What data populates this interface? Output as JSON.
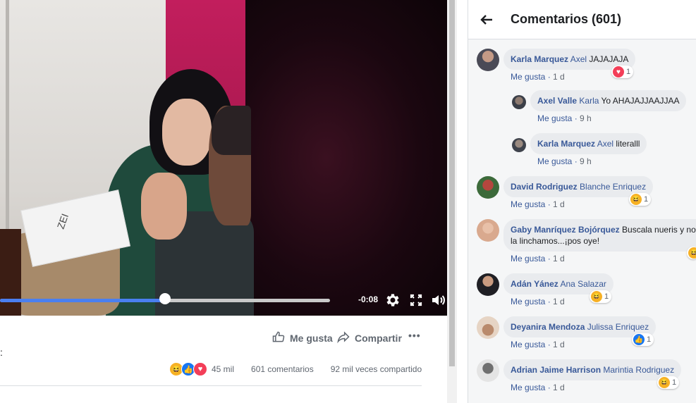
{
  "player": {
    "time_remaining": "-0:08",
    "progress": 0.5,
    "box_text": "ZEI"
  },
  "actions": {
    "like_label": "Me gusta",
    "share_label": "Compartir",
    "more_label": "•••"
  },
  "stats": {
    "reactions_count": "45 mil",
    "comments": "601 comentarios",
    "shares": "92 mil veces compartido"
  },
  "post_fragment": ":",
  "panel": {
    "title": "Comentarios (601)"
  },
  "comments": [
    {
      "author": "Karla Marquez",
      "tag": "Axel",
      "text": "JAJAJAJA",
      "like": "Me gusta",
      "time": "1 d",
      "reaction": "love",
      "count": "1"
    },
    {
      "author": "Axel Valle",
      "tag": "Karla",
      "text": "Yo AHAJAJJAAJJAA",
      "like": "Me gusta",
      "time": "9 h",
      "reply": true
    },
    {
      "author": "Karla Marquez",
      "tag": "Axel",
      "text": "literalll",
      "like": "Me gusta",
      "time": "9 h",
      "reply": true
    },
    {
      "author": "David Rodriguez",
      "tag": "Blanche Enriquez",
      "text": "",
      "like": "Me gusta",
      "time": "1 d",
      "reaction": "haha",
      "count": "1"
    },
    {
      "author": "Gaby Manríquez Bojórquez",
      "tag": "",
      "text": "Buscala nueris y nos",
      "text2": "la linchamos...¡pos oye!",
      "like": "Me gusta",
      "time": "1 d",
      "reaction": "haha"
    },
    {
      "author": "Adán Yánez",
      "tag": "Ana Salazar",
      "text": "",
      "like": "Me gusta",
      "time": "1 d",
      "reaction": "haha",
      "count": "1"
    },
    {
      "author": "Deyanira Mendoza",
      "tag": "Julissa Enriquez",
      "text": "",
      "like": "Me gusta",
      "time": "1 d",
      "reaction": "like",
      "count": "1"
    },
    {
      "author": "Adrian Jaime Harrison",
      "tag": "Marintia Rodriguez",
      "text": "",
      "like": "Me gusta",
      "time": "1 d",
      "reaction": "haha",
      "count": "1"
    }
  ],
  "colors": {
    "link": "#385898",
    "progress": "#4a7ff0",
    "bubble": "#e9ebee"
  }
}
